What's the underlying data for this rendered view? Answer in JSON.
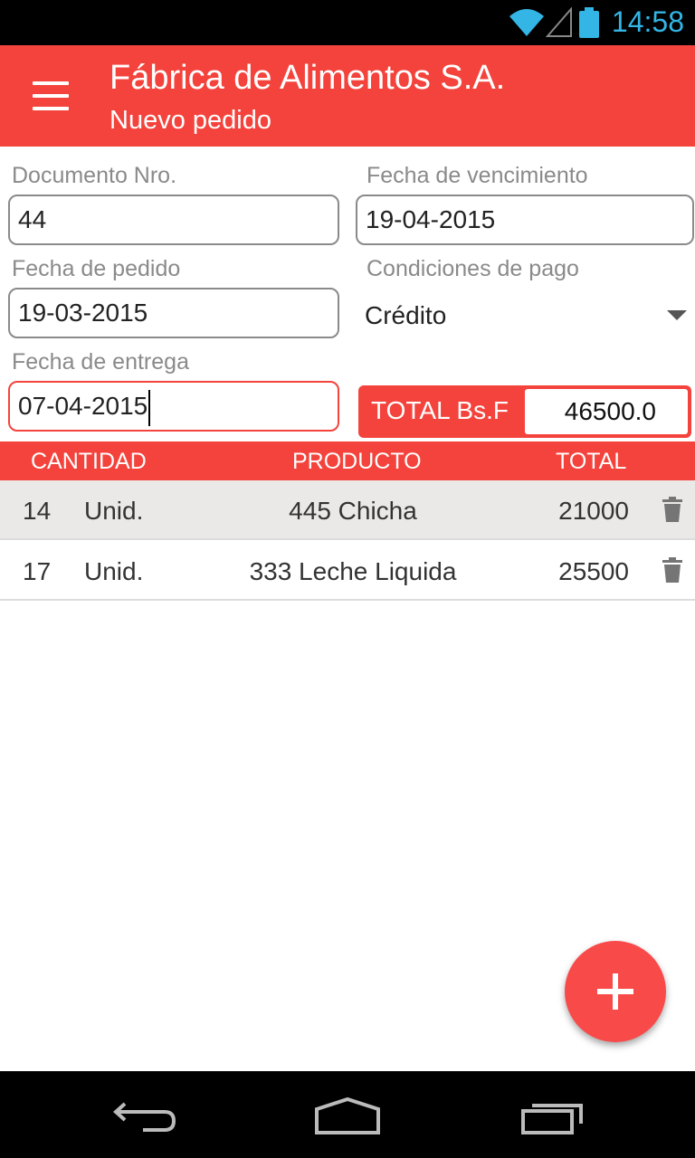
{
  "status_bar": {
    "time": "14:58",
    "icons": [
      "wifi-icon",
      "signal-icon",
      "battery-icon"
    ],
    "time_color": "#33b5e5"
  },
  "app_bar": {
    "title": "Fábrica de Alimentos S.A.",
    "subtitle": "Nuevo pedido",
    "menu_icon": "menu-icon",
    "color": "#f4433c"
  },
  "form": {
    "documento_label": "Documento Nro.",
    "documento_value": "44",
    "vencimiento_label": "Fecha de vencimiento",
    "vencimiento_value": "19-04-2015",
    "pedido_label": "Fecha de pedido",
    "pedido_value": "19-03-2015",
    "condiciones_label": "Condiciones de pago",
    "condiciones_value": "Crédito",
    "entrega_label": "Fecha de entrega",
    "entrega_value": "07-04-2015",
    "total_label": "TOTAL Bs.F",
    "total_value": "46500.0"
  },
  "table": {
    "headers": [
      "CANTIDAD",
      "PRODUCTO",
      "TOTAL"
    ],
    "rows": [
      {
        "qty": "14",
        "unit": "Unid.",
        "product": "445 Chicha",
        "total": "21000"
      },
      {
        "qty": "17",
        "unit": "Unid.",
        "product": "333 Leche Liquida",
        "total": "25500"
      }
    ]
  },
  "fab": {
    "icon": "add-icon"
  },
  "nav_bar": {
    "icons": [
      "back-icon",
      "home-icon",
      "recents-icon"
    ]
  }
}
